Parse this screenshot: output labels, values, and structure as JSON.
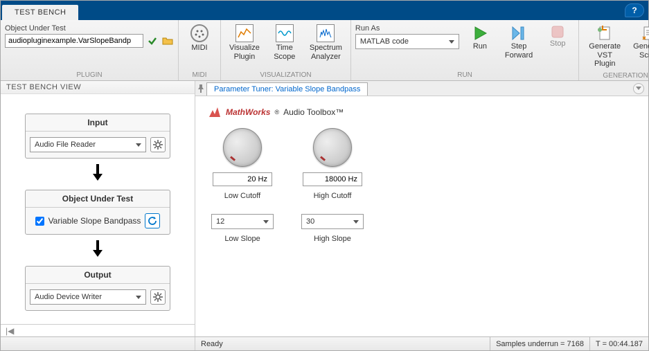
{
  "top": {
    "tab": "TEST BENCH",
    "help": "?"
  },
  "toolstrip": {
    "plugin": {
      "label_group": "PLUGIN",
      "label_out": "Object Under Test",
      "input_value": "audiopluginexample.VarSlopeBandp"
    },
    "midi": {
      "group": "MIDI",
      "btn": "MIDI"
    },
    "viz": {
      "group": "VISUALIZATION",
      "visualize": "Visualize\nPlugin",
      "timescope": "Time\nScope",
      "spectrum": "Spectrum\nAnalyzer"
    },
    "run": {
      "group": "RUN",
      "runas_label": "Run As",
      "runas_value": "MATLAB code",
      "run": "Run",
      "step": "Step\nForward",
      "stop": "Stop"
    },
    "gen": {
      "group": "GENERATION",
      "vst": "Generate\nVST Plugin",
      "script": "Generate\nScript"
    }
  },
  "left": {
    "header": "TEST BENCH VIEW",
    "input": {
      "title": "Input",
      "value": "Audio File Reader"
    },
    "out": {
      "title": "Object Under Test",
      "value": "Variable Slope Bandpass"
    },
    "output": {
      "title": "Output",
      "value": "Audio Device Writer"
    }
  },
  "right": {
    "tab": "Parameter Tuner: Variable Slope Bandpass",
    "brand_company": "MathWorks",
    "brand_reg": "®",
    "brand_product": " Audio Toolbox™",
    "params": {
      "low_cutoff": {
        "value": "20 Hz",
        "label": "Low Cutoff"
      },
      "high_cutoff": {
        "value": "18000 Hz",
        "label": "High Cutoff"
      },
      "low_slope": {
        "value": "12",
        "label": "Low Slope"
      },
      "high_slope": {
        "value": "30",
        "label": "High Slope"
      }
    }
  },
  "status": {
    "ready": "Ready",
    "underrun": "Samples underrun = 7168",
    "time": "T = 00:44.187"
  },
  "arrow": "↓",
  "chevron_l": "|◀",
  "chevron_r": "▶"
}
